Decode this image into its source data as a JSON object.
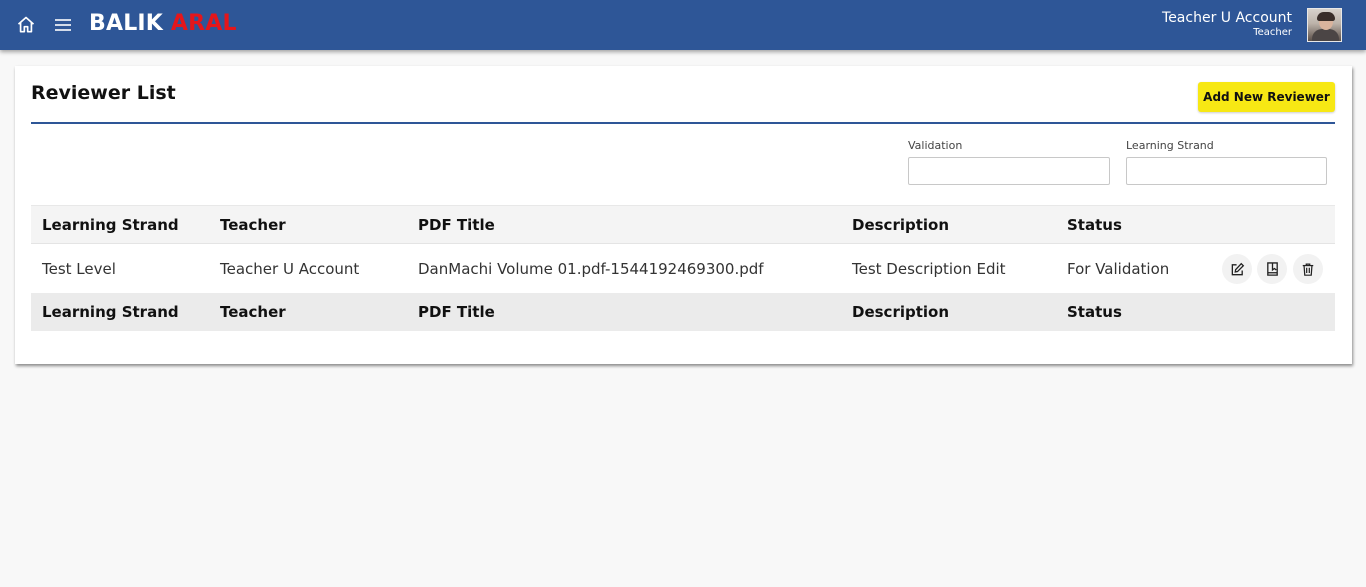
{
  "header": {
    "brand_primary": "BALIK",
    "brand_accent": "ARAL",
    "user_name": "Teacher U Account",
    "user_role": "Teacher",
    "icons": [
      "home-icon",
      "menu-icon"
    ],
    "colors": {
      "bar": "#2e5697",
      "brand_accent": "#e4161b"
    }
  },
  "page": {
    "title": "Reviewer List",
    "add_button": "Add New Reviewer",
    "add_button_color": "#f7e814"
  },
  "filters": {
    "validation_label": "Validation",
    "validation_value": "",
    "strand_label": "Learning Strand",
    "strand_value": ""
  },
  "table": {
    "columns": [
      "Learning Strand",
      "Teacher",
      "PDF Title",
      "Description",
      "Status"
    ],
    "rows": [
      {
        "strand": "Test Level",
        "teacher": "Teacher U Account",
        "pdf_title": "DanMachi Volume 01.pdf-1544192469300.pdf",
        "description": "Test Description Edit",
        "status": "For Validation",
        "actions": [
          "edit-icon",
          "document-icon",
          "trash-icon"
        ]
      }
    ]
  }
}
